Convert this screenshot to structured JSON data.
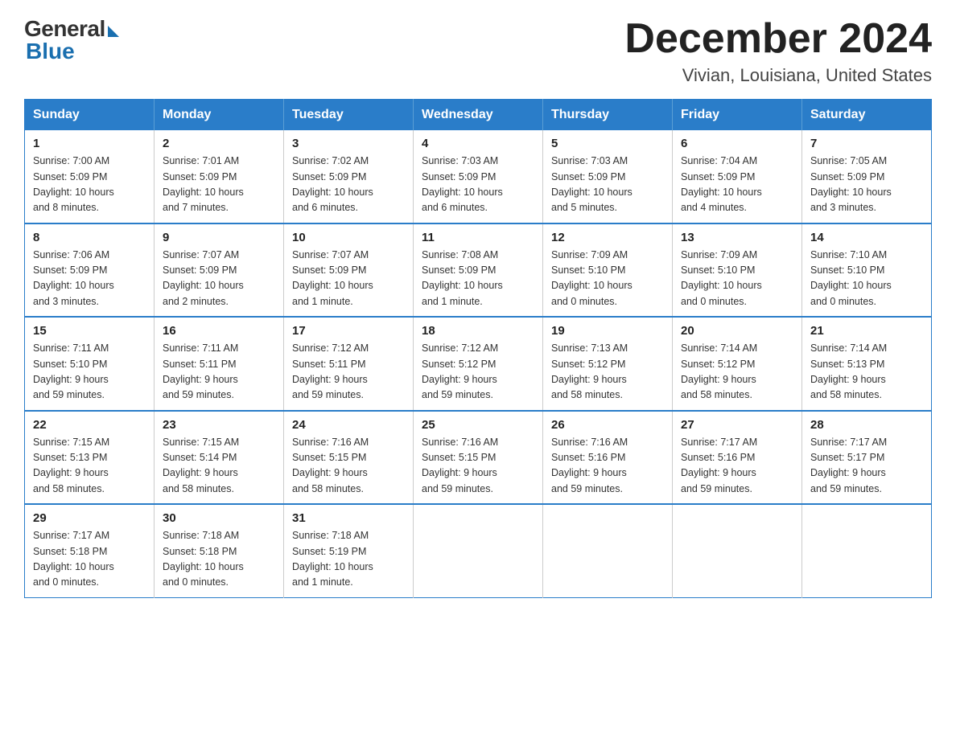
{
  "logo": {
    "general": "General",
    "blue": "Blue"
  },
  "title": {
    "month": "December 2024",
    "location": "Vivian, Louisiana, United States"
  },
  "weekdays": [
    "Sunday",
    "Monday",
    "Tuesday",
    "Wednesday",
    "Thursday",
    "Friday",
    "Saturday"
  ],
  "weeks": [
    [
      {
        "day": "1",
        "info": "Sunrise: 7:00 AM\nSunset: 5:09 PM\nDaylight: 10 hours\nand 8 minutes."
      },
      {
        "day": "2",
        "info": "Sunrise: 7:01 AM\nSunset: 5:09 PM\nDaylight: 10 hours\nand 7 minutes."
      },
      {
        "day": "3",
        "info": "Sunrise: 7:02 AM\nSunset: 5:09 PM\nDaylight: 10 hours\nand 6 minutes."
      },
      {
        "day": "4",
        "info": "Sunrise: 7:03 AM\nSunset: 5:09 PM\nDaylight: 10 hours\nand 6 minutes."
      },
      {
        "day": "5",
        "info": "Sunrise: 7:03 AM\nSunset: 5:09 PM\nDaylight: 10 hours\nand 5 minutes."
      },
      {
        "day": "6",
        "info": "Sunrise: 7:04 AM\nSunset: 5:09 PM\nDaylight: 10 hours\nand 4 minutes."
      },
      {
        "day": "7",
        "info": "Sunrise: 7:05 AM\nSunset: 5:09 PM\nDaylight: 10 hours\nand 3 minutes."
      }
    ],
    [
      {
        "day": "8",
        "info": "Sunrise: 7:06 AM\nSunset: 5:09 PM\nDaylight: 10 hours\nand 3 minutes."
      },
      {
        "day": "9",
        "info": "Sunrise: 7:07 AM\nSunset: 5:09 PM\nDaylight: 10 hours\nand 2 minutes."
      },
      {
        "day": "10",
        "info": "Sunrise: 7:07 AM\nSunset: 5:09 PM\nDaylight: 10 hours\nand 1 minute."
      },
      {
        "day": "11",
        "info": "Sunrise: 7:08 AM\nSunset: 5:09 PM\nDaylight: 10 hours\nand 1 minute."
      },
      {
        "day": "12",
        "info": "Sunrise: 7:09 AM\nSunset: 5:10 PM\nDaylight: 10 hours\nand 0 minutes."
      },
      {
        "day": "13",
        "info": "Sunrise: 7:09 AM\nSunset: 5:10 PM\nDaylight: 10 hours\nand 0 minutes."
      },
      {
        "day": "14",
        "info": "Sunrise: 7:10 AM\nSunset: 5:10 PM\nDaylight: 10 hours\nand 0 minutes."
      }
    ],
    [
      {
        "day": "15",
        "info": "Sunrise: 7:11 AM\nSunset: 5:10 PM\nDaylight: 9 hours\nand 59 minutes."
      },
      {
        "day": "16",
        "info": "Sunrise: 7:11 AM\nSunset: 5:11 PM\nDaylight: 9 hours\nand 59 minutes."
      },
      {
        "day": "17",
        "info": "Sunrise: 7:12 AM\nSunset: 5:11 PM\nDaylight: 9 hours\nand 59 minutes."
      },
      {
        "day": "18",
        "info": "Sunrise: 7:12 AM\nSunset: 5:12 PM\nDaylight: 9 hours\nand 59 minutes."
      },
      {
        "day": "19",
        "info": "Sunrise: 7:13 AM\nSunset: 5:12 PM\nDaylight: 9 hours\nand 58 minutes."
      },
      {
        "day": "20",
        "info": "Sunrise: 7:14 AM\nSunset: 5:12 PM\nDaylight: 9 hours\nand 58 minutes."
      },
      {
        "day": "21",
        "info": "Sunrise: 7:14 AM\nSunset: 5:13 PM\nDaylight: 9 hours\nand 58 minutes."
      }
    ],
    [
      {
        "day": "22",
        "info": "Sunrise: 7:15 AM\nSunset: 5:13 PM\nDaylight: 9 hours\nand 58 minutes."
      },
      {
        "day": "23",
        "info": "Sunrise: 7:15 AM\nSunset: 5:14 PM\nDaylight: 9 hours\nand 58 minutes."
      },
      {
        "day": "24",
        "info": "Sunrise: 7:16 AM\nSunset: 5:15 PM\nDaylight: 9 hours\nand 58 minutes."
      },
      {
        "day": "25",
        "info": "Sunrise: 7:16 AM\nSunset: 5:15 PM\nDaylight: 9 hours\nand 59 minutes."
      },
      {
        "day": "26",
        "info": "Sunrise: 7:16 AM\nSunset: 5:16 PM\nDaylight: 9 hours\nand 59 minutes."
      },
      {
        "day": "27",
        "info": "Sunrise: 7:17 AM\nSunset: 5:16 PM\nDaylight: 9 hours\nand 59 minutes."
      },
      {
        "day": "28",
        "info": "Sunrise: 7:17 AM\nSunset: 5:17 PM\nDaylight: 9 hours\nand 59 minutes."
      }
    ],
    [
      {
        "day": "29",
        "info": "Sunrise: 7:17 AM\nSunset: 5:18 PM\nDaylight: 10 hours\nand 0 minutes."
      },
      {
        "day": "30",
        "info": "Sunrise: 7:18 AM\nSunset: 5:18 PM\nDaylight: 10 hours\nand 0 minutes."
      },
      {
        "day": "31",
        "info": "Sunrise: 7:18 AM\nSunset: 5:19 PM\nDaylight: 10 hours\nand 1 minute."
      },
      null,
      null,
      null,
      null
    ]
  ]
}
